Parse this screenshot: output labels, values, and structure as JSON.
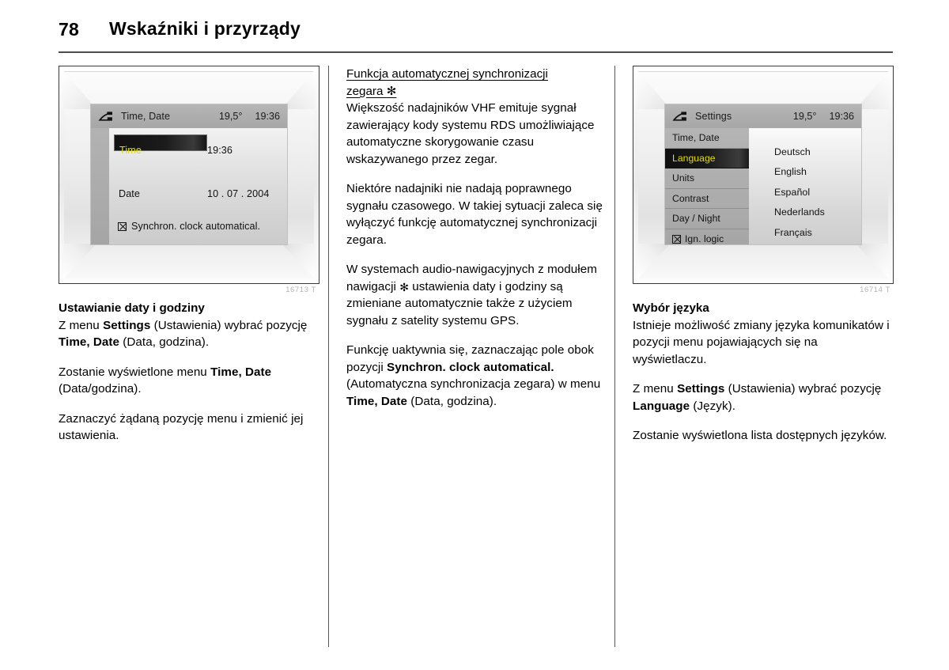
{
  "header": {
    "page_number": "78",
    "title": "Wskaźniki i przyrządy"
  },
  "left_column": {
    "figure": {
      "code": "16713 T",
      "screen": {
        "icon": "settings-wrench-icon",
        "title": "Time, Date",
        "temperature": "19,5°",
        "clock": "19:36",
        "rows": [
          {
            "label": "Time",
            "value": "19:36",
            "selected": true
          },
          {
            "label": "Date",
            "value": "10 . 07 . 2004",
            "selected": false
          }
        ],
        "checkbox": {
          "glyph": "checkbox-checked-icon",
          "label": "Synchron. clock automatical."
        }
      }
    },
    "heading": "Ustawianie daty i godziny",
    "paragraphs": [
      {
        "parts": [
          {
            "t": "Z menu ",
            "b": false
          },
          {
            "t": "Settings",
            "b": true
          },
          {
            "t": " (Ustawienia) wybrać pozycję ",
            "b": false
          },
          {
            "t": "Time, Date",
            "b": true
          },
          {
            "t": " (Data, godzina).",
            "b": false
          }
        ]
      },
      {
        "parts": [
          {
            "t": "Zostanie wyświetlone menu ",
            "b": false
          },
          {
            "t": "Time, Date",
            "b": true
          },
          {
            "t": " (Data/godzina).",
            "b": false
          }
        ]
      },
      {
        "parts": [
          {
            "t": "Zaznaczyć żądaną pozycję menu i zmienić jej ustawienia.",
            "b": false
          }
        ]
      }
    ]
  },
  "middle_column": {
    "heading_line1": "Funkcja automatycznej synchronizacji",
    "heading_line2": "zegara",
    "heading_symbol": "✻",
    "paragraphs": [
      {
        "parts": [
          {
            "t": "Większość nadajników VHF emituje sygnał zawierający kody systemu RDS umożliwiające automatyczne skorygowanie czasu wskazywanego przez zegar.",
            "b": false
          }
        ]
      },
      {
        "parts": [
          {
            "t": "Niektóre nadajniki nie nadają poprawnego sygnału czasowego. W takiej sytuacji zaleca się wyłączyć funkcję automatycznej synchronizacji zegara.",
            "b": false
          }
        ]
      },
      {
        "parts": [
          {
            "t": "W systemach audio-nawigacyjnych z modułem nawigacji ",
            "b": false
          },
          {
            "t": "✻",
            "b": false,
            "sym": true
          },
          {
            "t": " ustawienia daty i godziny są zmieniane automatycznie także z użyciem sygnału z satelity systemu GPS.",
            "b": false
          }
        ]
      },
      {
        "parts": [
          {
            "t": "Funkcję uaktywnia się, zaznaczając pole obok pozycji ",
            "b": false
          },
          {
            "t": "Synchron. clock automatical.",
            "b": true
          },
          {
            "t": " (Automatyczna synchronizacja zegara) w menu ",
            "b": false
          },
          {
            "t": "Time, Date",
            "b": true
          },
          {
            "t": " (Data, godzina).",
            "b": false
          }
        ]
      }
    ]
  },
  "right_column": {
    "figure": {
      "code": "16714 T",
      "screen": {
        "icon": "settings-wrench-icon",
        "title": "Settings",
        "temperature": "19,5°",
        "clock": "19:36",
        "menu_items": [
          {
            "label": "Time, Date",
            "selected": false,
            "checkbox": false
          },
          {
            "label": "Language",
            "selected": true,
            "checkbox": false
          },
          {
            "label": "Units",
            "selected": false,
            "checkbox": false
          },
          {
            "label": "Contrast",
            "selected": false,
            "checkbox": false
          },
          {
            "label": "Day / Night",
            "selected": false,
            "checkbox": false
          },
          {
            "label": "Ign. logic",
            "selected": false,
            "checkbox": true
          }
        ],
        "languages": [
          "Deutsch",
          "English",
          "Español",
          "Nederlands",
          "Français"
        ]
      }
    },
    "heading": "Wybór języka",
    "paragraphs": [
      {
        "parts": [
          {
            "t": "Istnieje możliwość zmiany języka komunikatów i pozycji menu pojawiających się na wyświetlaczu.",
            "b": false
          }
        ]
      },
      {
        "parts": [
          {
            "t": "Z menu ",
            "b": false
          },
          {
            "t": "Settings",
            "b": true
          },
          {
            "t": " (Ustawienia) wybrać pozycję ",
            "b": false
          },
          {
            "t": "Language",
            "b": true
          },
          {
            "t": " (Język).",
            "b": false
          }
        ]
      },
      {
        "parts": [
          {
            "t": "Zostanie wyświetlona lista dostępnych języków.",
            "b": false
          }
        ]
      }
    ]
  },
  "colors": {
    "accent_yellow": "#e3dc00",
    "screen_header_gray": "#adadad",
    "rule_gray": "#4d4d4d"
  }
}
